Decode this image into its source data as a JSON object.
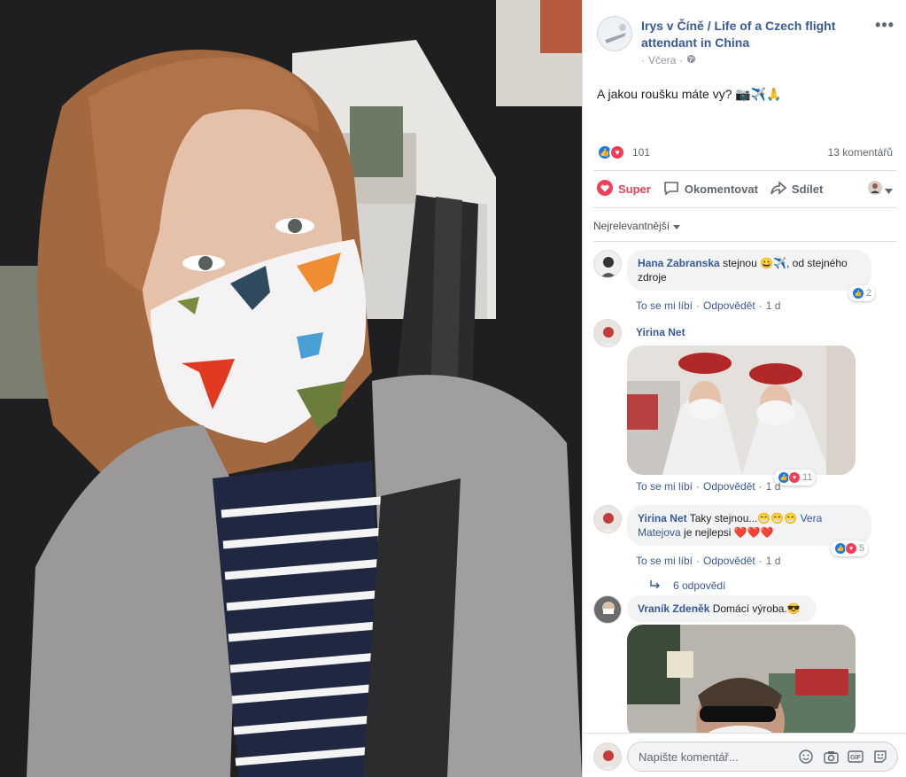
{
  "post": {
    "page_name": "Irys v Číně / Life of a Czech flight attendant in China",
    "time": "Včera",
    "text": "A jakou roušku máte vy? 📷✈️🙏",
    "reaction_count": "101",
    "comment_count": "13 komentářů"
  },
  "actions": {
    "super": "Super",
    "comment": "Okomentovat",
    "share": "Sdílet"
  },
  "sort_label": "Nejrelevantnější",
  "comment_actions": {
    "like": "To se mi líbí",
    "reply": "Odpovědět"
  },
  "comments": [
    {
      "author": "Hana Zabranska",
      "text": "stejnou 😀✈️, od stejného zdroje",
      "time": "1 d",
      "reactions": "2"
    },
    {
      "author": "Yirina Net",
      "text": "",
      "time": "1 d",
      "reactions": "11"
    },
    {
      "author": "Yirina Net",
      "text_before": "Taky stejnou...😁😁😁",
      "mention": "Vera Matejova",
      "text_after": "je nejlepsi ❤️❤️❤️",
      "time": "1 d",
      "reactions": "5",
      "replies": "6 odpovědí"
    },
    {
      "author": "Vraník Zdeněk",
      "text": "Domácí výroba.😎"
    }
  ],
  "composer": {
    "placeholder": "Napište komentář..."
  },
  "colors": {
    "link": "#385898",
    "super": "#f33e58",
    "like": "#1877f2"
  }
}
